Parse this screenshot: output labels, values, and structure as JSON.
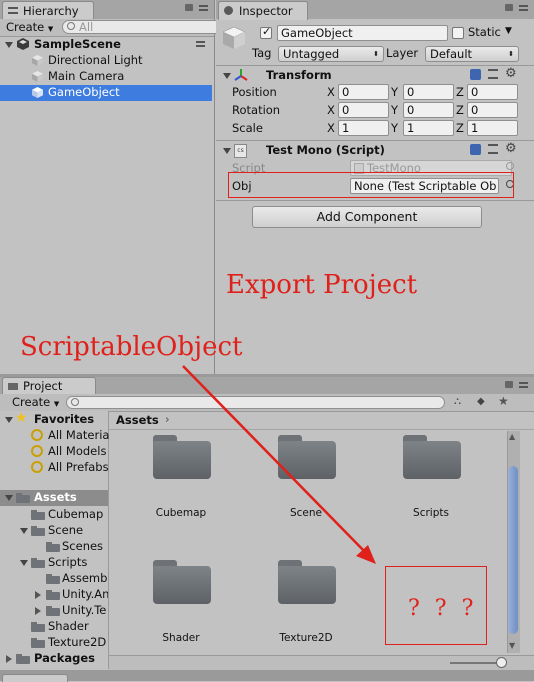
{
  "hierarchy": {
    "tab": "Hierarchy",
    "create": "Create",
    "search_value": "All",
    "scene": "SampleScene",
    "items": [
      "Directional Light",
      "Main Camera",
      "GameObject"
    ]
  },
  "inspector": {
    "tab": "Inspector",
    "object_name": "GameObject",
    "static_label": "Static",
    "tag_label": "Tag",
    "tag_value": "Untagged",
    "layer_label": "Layer",
    "layer_value": "Default",
    "transform": {
      "title": "Transform",
      "rows": [
        {
          "label": "Position",
          "x": "0",
          "y": "0",
          "z": "0"
        },
        {
          "label": "Rotation",
          "x": "0",
          "y": "0",
          "z": "0"
        },
        {
          "label": "Scale",
          "x": "1",
          "y": "1",
          "z": "1"
        }
      ],
      "axis": [
        "X",
        "Y",
        "Z"
      ]
    },
    "script_component": {
      "title": "Test Mono (Script)",
      "script_label": "Script",
      "script_value": "TestMono",
      "obj_label": "Obj",
      "obj_value": "None (Test Scriptable Ob"
    },
    "add_component": "Add Component"
  },
  "annotations": {
    "export": "Export Project",
    "scriptable": "ScriptableObject",
    "question": "? ? ?",
    "color": "#e0201a"
  },
  "project": {
    "tab": "Project",
    "create": "Create",
    "favorites": "Favorites",
    "fav_items": [
      "All Materia",
      "All Models",
      "All Prefabs"
    ],
    "assets": "Assets",
    "tree": [
      "Cubemap",
      "Scene",
      "Scenes",
      "Scripts",
      "Assembl",
      "Unity.An",
      "Unity.Te",
      "Shader",
      "Texture2D"
    ],
    "packages": "Packages",
    "breadcrumb": "Assets",
    "grid": [
      "Cubemap",
      "Scene",
      "Scripts",
      "Shader",
      "Texture2D"
    ]
  },
  "colors": {
    "selection": "#3e7ce0",
    "panel": "#c2c2c2",
    "header": "#a5a5a5"
  }
}
